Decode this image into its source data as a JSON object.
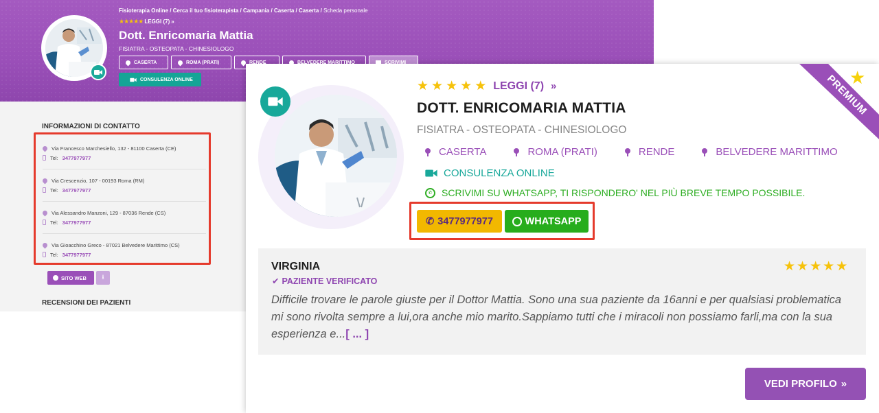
{
  "background_page": {
    "breadcrumb": {
      "items": [
        "Fisioterapia Online",
        "Cerca il tuo fisioterapista",
        "Campania",
        "Caserta",
        "Caserta"
      ],
      "current": "Scheda personale",
      "separator": "/"
    },
    "rating_label": "LEGGI (7)",
    "rating_chevron": "»",
    "name": "Dott. Enricomaria Mattia",
    "specialty": "FISIATRA - OSTEOPATA - CHINESIOLOGO",
    "location_chips": [
      "CASERTA",
      "ROMA (PRATI)",
      "RENDE",
      "BELVEDERE MARITTIMO",
      "SCRIVIMI"
    ],
    "online_button": "CONSULENZA ONLINE",
    "contact_section_title": "INFORMAZIONI DI CONTATTO",
    "tel_prefix": "Tel:",
    "addresses": [
      {
        "address": "Via Francesco Marchesiello, 132 - 81100 Caserta (CE)",
        "phone": "3477977977"
      },
      {
        "address": "Via Crescenzio, 107 - 00193 Roma (RM)",
        "phone": "3477977977"
      },
      {
        "address": "Via Alessandro Manzoni, 129 - 87036 Rende (CS)",
        "phone": "3477977977"
      },
      {
        "address": "Via Gioacchino Greco - 87021 Belvedere Marittimo (CS)",
        "phone": "3477977977"
      }
    ],
    "website_button": "SITO WEB",
    "reviews_section_title": "RECENSIONI DEI PAZIENTI"
  },
  "card": {
    "premium_label": "PREMIUM",
    "rating_label": "LEGGI (7)",
    "rating_chevron": "»",
    "name": "DOTT. ENRICOMARIA MATTIA",
    "specialty": "FISIATRA - OSTEOPATA - CHINESIOLOGO",
    "locations": [
      "CASERTA",
      "ROMA (PRATI)",
      "RENDE",
      "BELVEDERE MARITTIMO"
    ],
    "online_label": "CONSULENZA ONLINE",
    "whatsapp_note": "SCRIVIMI SU WHATSAPP, TI RISPONDERO' NEL PIÙ BREVE TEMPO POSSIBILE.",
    "phone_button": "3477977977",
    "whatsapp_button": "WHATSAPP",
    "review": {
      "author": "VIRGINIA",
      "verified": "PAZIENTE VERIFICATO",
      "text": "Difficile trovare le parole giuste per il Dottor Mattia. Sono una sua paziente da 16anni e per qualsiasi problematica mi sono rivolta sempre a lui,ora anche mio marito.Sappiamo tutti che i miracoli non possiamo farli,ma con la sua esperienza e...",
      "more": "[ ... ]",
      "stars": 5
    },
    "profile_button": "VEDI PROFILO",
    "profile_chevron": "»"
  },
  "colors": {
    "brand_purple": "#9a4fb8",
    "teal": "#18a89a",
    "whatsapp_green": "#27ad1c",
    "phone_yellow": "#f2b800",
    "highlight_red": "#e53a2c",
    "star_gold": "#f6c20a"
  }
}
